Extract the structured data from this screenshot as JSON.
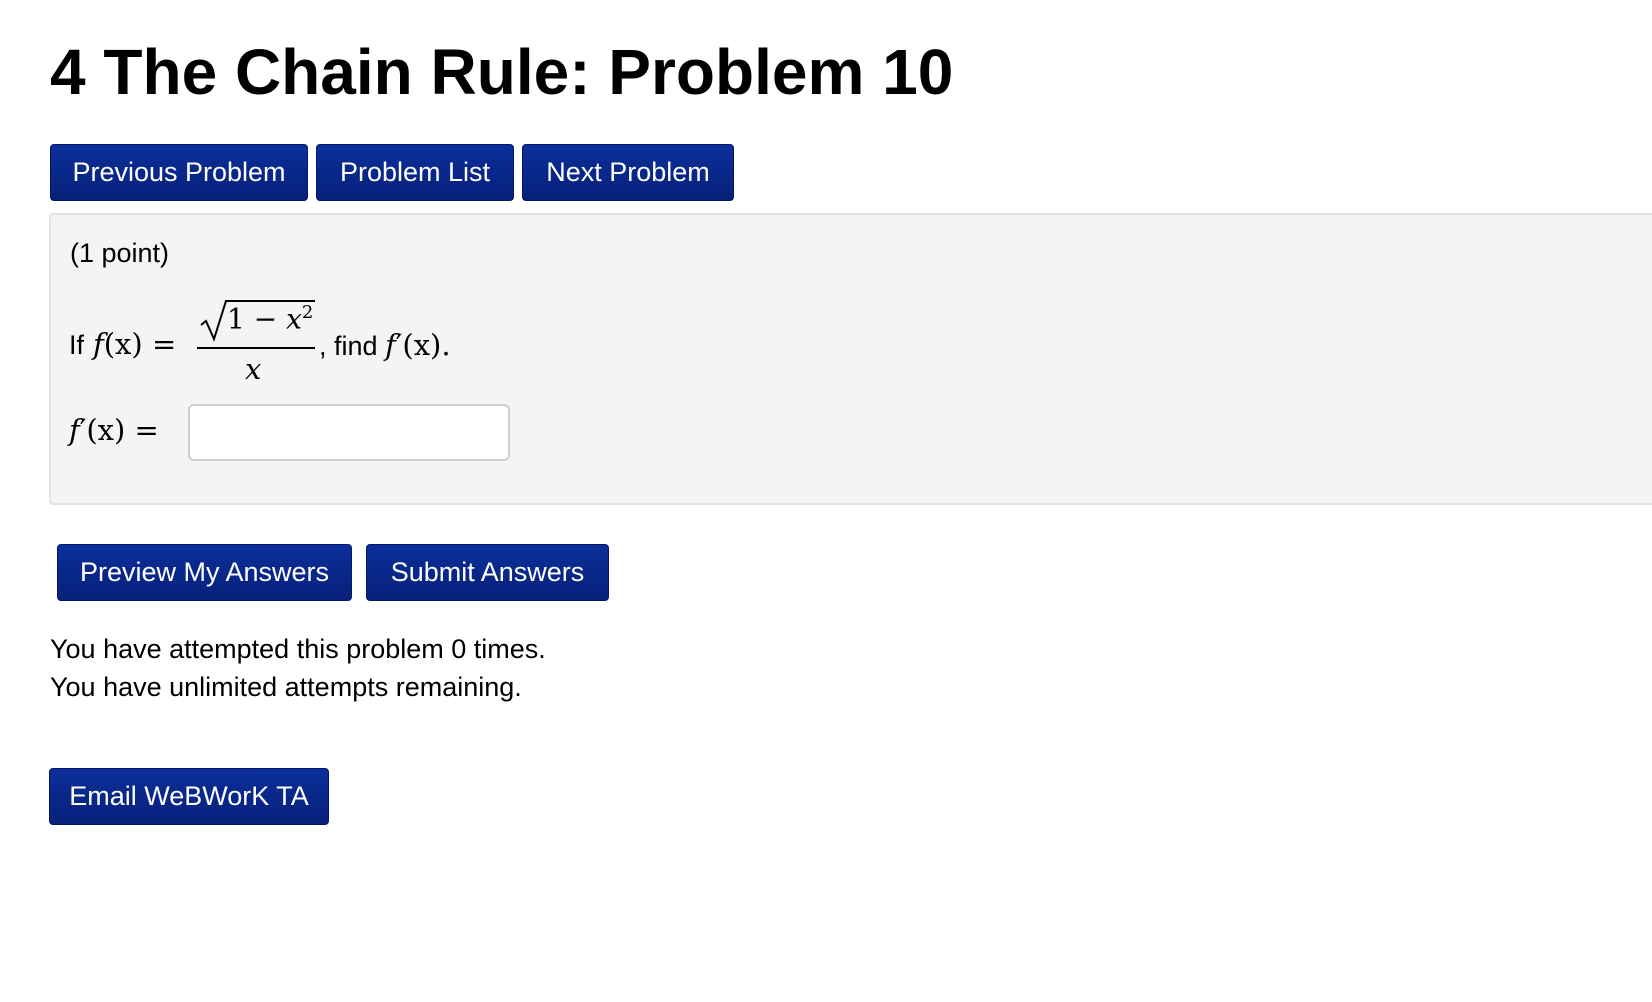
{
  "header": {
    "title": "4 The Chain Rule: Problem 10"
  },
  "nav": {
    "previous_label": "Previous Problem",
    "list_label": "Problem List",
    "next_label": "Next Problem"
  },
  "problem": {
    "points": "(1 point)",
    "question": {
      "prefix": "If",
      "lhs_f": "f",
      "lhs_paren": "(x)",
      "equals": "=",
      "numerator_one": "1",
      "numerator_minus": "−",
      "numerator_x": "x",
      "numerator_exp": "2",
      "denominator": "x",
      "find_text": ", find",
      "target_f": "f",
      "target_prime_paren": "′(x).",
      "target_x": "x"
    },
    "answer": {
      "label_f": "f",
      "label_rest": "′(x) =",
      "value": "",
      "placeholder": ""
    }
  },
  "actions": {
    "preview_label": "Preview My Answers",
    "submit_label": "Submit Answers"
  },
  "status": {
    "attempts_line": "You have attempted this problem 0 times.",
    "remaining_line": "You have unlimited attempts remaining."
  },
  "footer": {
    "email_label": "Email WeBWorK TA"
  },
  "colors": {
    "button_bg": "#0b2f9a",
    "button_text": "#ffffff",
    "problem_bg": "#f4f4f4",
    "problem_border": "#e3e3e3"
  }
}
